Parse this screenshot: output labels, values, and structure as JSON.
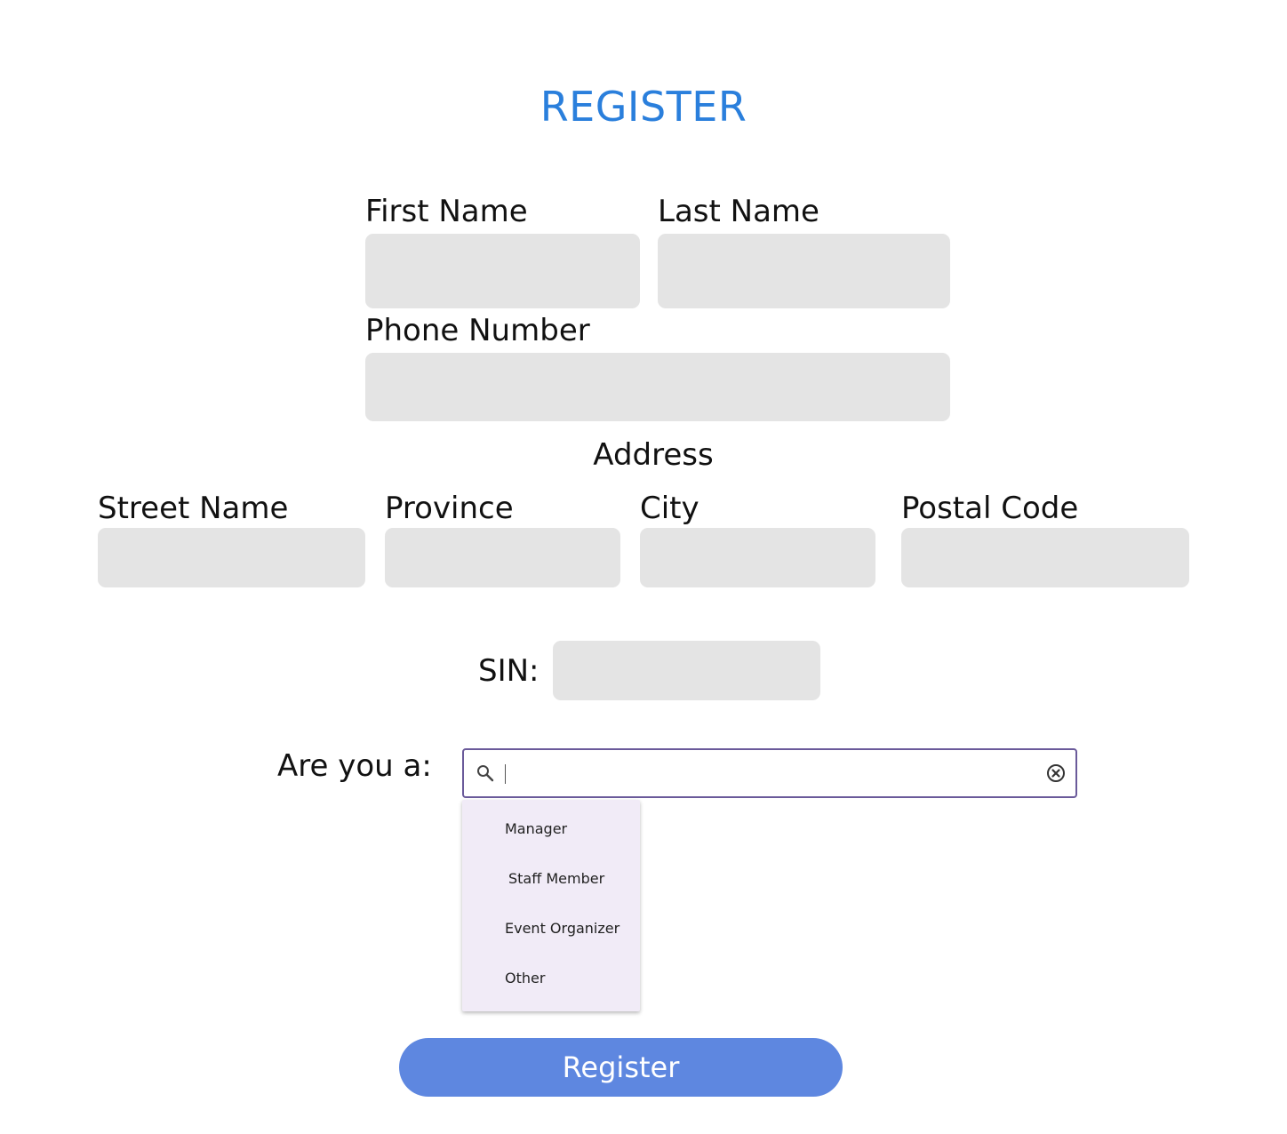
{
  "page": {
    "title": "REGISTER"
  },
  "form": {
    "first_name_label": "First Name",
    "first_name_value": "",
    "last_name_label": "Last Name",
    "last_name_value": "",
    "phone_label": "Phone Number",
    "phone_value": "",
    "address_heading": "Address",
    "street_label": "Street Name",
    "street_value": "",
    "province_label": "Province",
    "province_value": "",
    "city_label": "City",
    "city_value": "",
    "postal_label": "Postal Code",
    "postal_value": "",
    "sin_label": "SIN:",
    "sin_value": "",
    "role_label": "Are you a:",
    "role_search_value": "",
    "role_options": [
      "Manager",
      "Staff Member",
      "Event Organizer",
      "Other"
    ],
    "register_label": "Register"
  },
  "icons": {
    "search": "search-icon",
    "clear": "clear-circle-icon"
  },
  "colors": {
    "title": "#2a7fdc",
    "field_bg": "#e4e4e4",
    "search_border": "#6a5a9a",
    "dropdown_bg": "#f1ebf7",
    "button_bg": "#5e87e0",
    "button_text": "#ffffff"
  }
}
